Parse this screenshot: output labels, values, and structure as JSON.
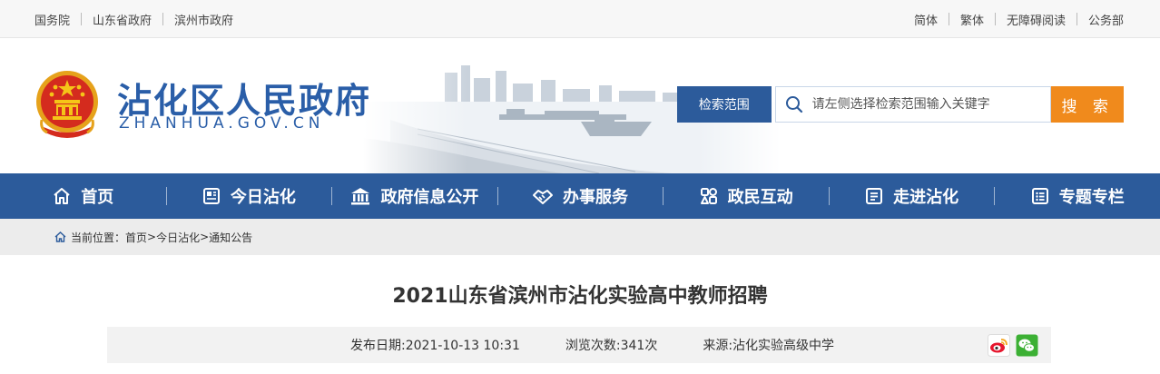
{
  "topbar": {
    "left_links": [
      "国务院",
      "山东省政府",
      "滨州市政府"
    ],
    "right_links": [
      "简体",
      "繁体",
      "无障碍阅读",
      "公务部"
    ]
  },
  "header": {
    "site_title": "沾化区人民政府",
    "site_domain": "ZHANHUA.GOV.CN",
    "search": {
      "scope_label": "检索范围",
      "placeholder": "请左侧选择检索范围输入关键字",
      "button_label": "搜 索"
    }
  },
  "nav": {
    "items": [
      {
        "label": "首页",
        "icon": "home-icon"
      },
      {
        "label": "今日沾化",
        "icon": "newspaper-icon"
      },
      {
        "label": "政府信息公开",
        "icon": "government-building-icon"
      },
      {
        "label": "办事服务",
        "icon": "handshake-icon"
      },
      {
        "label": "政民互动",
        "icon": "interaction-icon"
      },
      {
        "label": "走进沾化",
        "icon": "info-card-icon"
      },
      {
        "label": "专题专栏",
        "icon": "list-icon"
      }
    ]
  },
  "breadcrumb": {
    "prefix": "当前位置：",
    "items": [
      "首页",
      "今日沾化",
      "通知公告"
    ],
    "separator": ">"
  },
  "article": {
    "title": "2021山东省滨州市沾化实验高中教师招聘",
    "publish_date": "发布日期:2021-10-13 10:31",
    "views": "浏览次数:341次",
    "source": "来源:沾化实验高级中学"
  },
  "share": {
    "icons": [
      "weibo-icon",
      "wechat-icon"
    ]
  },
  "colors": {
    "brand_blue": "#2c5b9b",
    "title_blue": "#2a5ea8",
    "search_orange": "#f08a1c",
    "breadcrumb_bg": "#ececec"
  }
}
